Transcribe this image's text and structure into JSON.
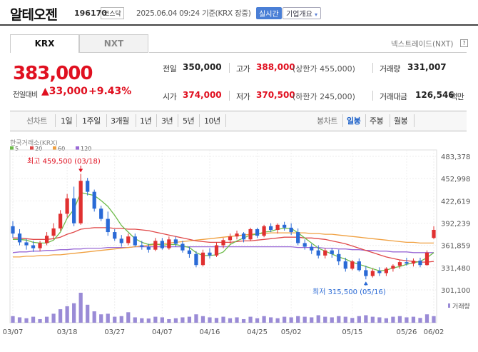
{
  "header": {
    "name": "알테오젠",
    "code": "196170",
    "market": "코스닥",
    "datetime": "2025.06.04 09:24 기준(KRX 장중)",
    "realtime_btn": "실시간",
    "company_btn": "기업개요",
    "company_btn_arrow": "▾"
  },
  "tabs": {
    "krx": "KRX",
    "nxt": "NXT"
  },
  "nextrade": {
    "label": "넥스트레이드(NXT)",
    "icon_glyph": "?"
  },
  "quote": {
    "price": "383,000",
    "change_label": "전일대비",
    "change_arrow": "▲",
    "change_value": "33,000",
    "change_pct": "+9.43%"
  },
  "stats": {
    "prev_close": {
      "label": "전일",
      "value": "350,000"
    },
    "high": {
      "label": "고가",
      "value": "388,000",
      "sub": "(상한가 455,000)"
    },
    "volume": {
      "label": "거래량",
      "value": "331,007"
    },
    "open": {
      "label": "시가",
      "value": "374,000"
    },
    "low": {
      "label": "저가",
      "value": "370,500",
      "sub": "(하한가 245,000)"
    },
    "trade_value": {
      "label": "거래대금",
      "value": "126,546",
      "unit": "백만"
    }
  },
  "period_bar": {
    "line_label": "선차트",
    "line_periods": [
      "1일",
      "1주일",
      "3개월",
      "1년",
      "3년",
      "5년",
      "10년"
    ],
    "candle_label": "봉차트",
    "candle_periods": [
      "일봉",
      "주봉",
      "월봉"
    ],
    "active": "일봉"
  },
  "chart_source": "한국거래소(KRX)",
  "chart_data": {
    "type": "candlestick",
    "moving_averages": [
      {
        "name": "5",
        "color": "#6dbb4a"
      },
      {
        "name": "20",
        "color": "#e04848"
      },
      {
        "name": "60",
        "color": "#f0a040"
      },
      {
        "name": "120",
        "color": "#9a6ad6"
      }
    ],
    "up_color": "#e03030",
    "down_color": "#2a6ad6",
    "y_ticks": [
      "483,378",
      "452,998",
      "422,619",
      "392,239",
      "361,859",
      "331,480",
      "301,100"
    ],
    "ylim": [
      301100,
      483378
    ],
    "x_ticks": [
      "03/07",
      "03/18",
      "03/27",
      "04/07",
      "04/16",
      "04/25",
      "05/02",
      "05/15",
      "05/26",
      "06/02"
    ],
    "max_annotation": "최고 459,500 (03/18)",
    "min_annotation": "최저 315,500 (05/16)",
    "volume_label": "거래량",
    "candles": [
      [
        388000,
        395000,
        372000,
        378000
      ],
      [
        378000,
        384000,
        362000,
        366000
      ],
      [
        366000,
        371000,
        356000,
        362000
      ],
      [
        362000,
        368000,
        353000,
        358000
      ],
      [
        358000,
        368000,
        354000,
        365000
      ],
      [
        365000,
        380000,
        362000,
        375000
      ],
      [
        375000,
        392000,
        370000,
        385000
      ],
      [
        385000,
        410000,
        382000,
        405000
      ],
      [
        405000,
        432000,
        400000,
        426000
      ],
      [
        426000,
        442000,
        388000,
        392000
      ],
      [
        392000,
        459500,
        390000,
        450000
      ],
      [
        450000,
        454000,
        430000,
        435000
      ],
      [
        435000,
        438000,
        408000,
        412000
      ],
      [
        412000,
        416000,
        395000,
        398000
      ],
      [
        398000,
        408000,
        375000,
        380000
      ],
      [
        380000,
        384000,
        368000,
        371000
      ],
      [
        371000,
        376000,
        360000,
        365000
      ],
      [
        365000,
        378000,
        362000,
        374000
      ],
      [
        374000,
        378000,
        360000,
        362000
      ],
      [
        362000,
        368000,
        356000,
        360000
      ],
      [
        360000,
        364000,
        352000,
        356000
      ],
      [
        356000,
        372000,
        354000,
        368000
      ],
      [
        368000,
        372000,
        356000,
        358000
      ],
      [
        358000,
        374000,
        356000,
        370000
      ],
      [
        370000,
        374000,
        360000,
        364000
      ],
      [
        364000,
        368000,
        352000,
        355000
      ],
      [
        355000,
        360000,
        345000,
        350000
      ],
      [
        350000,
        354000,
        332000,
        335000
      ],
      [
        335000,
        356000,
        333000,
        352000
      ],
      [
        352000,
        358000,
        344000,
        348000
      ],
      [
        348000,
        366000,
        346000,
        362000
      ],
      [
        362000,
        372000,
        358000,
        369000
      ],
      [
        369000,
        378000,
        364000,
        374000
      ],
      [
        374000,
        382000,
        370000,
        378000
      ],
      [
        378000,
        380000,
        366000,
        370000
      ],
      [
        370000,
        386000,
        368000,
        384000
      ],
      [
        384000,
        386000,
        372000,
        375000
      ],
      [
        375000,
        390000,
        373000,
        388000
      ],
      [
        388000,
        392000,
        380000,
        383000
      ],
      [
        383000,
        392000,
        378000,
        390000
      ],
      [
        390000,
        394000,
        382000,
        386000
      ],
      [
        386000,
        392000,
        376000,
        380000
      ],
      [
        380000,
        385000,
        362000,
        365000
      ],
      [
        365000,
        370000,
        356000,
        360000
      ],
      [
        360000,
        364000,
        350000,
        355000
      ],
      [
        355000,
        362000,
        344000,
        348000
      ],
      [
        348000,
        358000,
        344000,
        355000
      ],
      [
        355000,
        358000,
        345000,
        350000
      ],
      [
        350000,
        356000,
        335000,
        340000
      ],
      [
        340000,
        345000,
        326000,
        330000
      ],
      [
        330000,
        342000,
        328000,
        340000
      ],
      [
        340000,
        344000,
        326000,
        328000
      ],
      [
        328000,
        334000,
        315500,
        320000
      ],
      [
        320000,
        330000,
        318000,
        327000
      ],
      [
        327000,
        332000,
        320000,
        324000
      ],
      [
        324000,
        332000,
        320000,
        330000
      ],
      [
        330000,
        336000,
        326000,
        334000
      ],
      [
        334000,
        342000,
        330000,
        339000
      ],
      [
        339000,
        345000,
        334000,
        337000
      ],
      [
        337000,
        344000,
        333000,
        341000
      ],
      [
        341000,
        345000,
        332000,
        335000
      ],
      [
        335000,
        355000,
        334000,
        352000
      ],
      [
        372000,
        388000,
        370500,
        383000
      ]
    ],
    "ma5": [
      370000,
      370000,
      369000,
      366000,
      365000,
      365000,
      369000,
      380000,
      399000,
      411000,
      434000,
      432000,
      430000,
      423000,
      415000,
      403000,
      389000,
      380000,
      371000,
      366000,
      363000,
      364000,
      362000,
      363000,
      363000,
      361000,
      359000,
      352000,
      348000,
      348000,
      349000,
      353000,
      363000,
      368000,
      372000,
      376000,
      377000,
      380000,
      381000,
      384000,
      385000,
      385000,
      379000,
      372000,
      365000,
      358000,
      354000,
      350000,
      346000,
      343000,
      339000,
      336000,
      333000,
      330000,
      327000,
      328000,
      331000,
      333000,
      336000,
      338000,
      340000,
      345000,
      352000
    ],
    "ma20": [
      372000,
      372000,
      371000,
      370000,
      370000,
      370000,
      371000,
      373000,
      377000,
      380000,
      384000,
      385000,
      386000,
      386000,
      386000,
      385000,
      385000,
      384000,
      384000,
      383000,
      382000,
      380000,
      378000,
      376000,
      374000,
      372000,
      370000,
      368000,
      367000,
      366000,
      366000,
      366000,
      366000,
      367000,
      368000,
      368000,
      369000,
      370000,
      371000,
      372000,
      373000,
      373000,
      373000,
      372000,
      372000,
      371000,
      370000,
      368000,
      366000,
      364000,
      361000,
      358000,
      355000,
      352000,
      349000,
      346000,
      344000,
      342000,
      341000,
      340000,
      339000,
      339000,
      340000
    ],
    "ma60": [
      346000,
      346000,
      347000,
      347000,
      348000,
      348000,
      349000,
      349000,
      350000,
      351000,
      352000,
      353000,
      354000,
      355000,
      356000,
      357000,
      358000,
      359000,
      360000,
      361000,
      362000,
      363000,
      364000,
      365000,
      366000,
      367000,
      368000,
      369000,
      370000,
      371000,
      372000,
      373000,
      374000,
      375000,
      376000,
      377000,
      378000,
      378000,
      379000,
      379000,
      379000,
      379000,
      379000,
      379000,
      378000,
      378000,
      377000,
      377000,
      376000,
      375000,
      374000,
      373000,
      372000,
      371000,
      370000,
      369000,
      368000,
      367000,
      366000,
      366000,
      365000,
      365000,
      365000
    ],
    "ma120": [
      352000,
      353000,
      353000,
      354000,
      354000,
      355000,
      355000,
      356000,
      356000,
      357000,
      357000,
      358000,
      358000,
      358000,
      359000,
      359000,
      359000,
      359000,
      360000,
      360000,
      360000,
      360000,
      360000,
      360000,
      360000,
      360000,
      360000,
      360000,
      360000,
      360000,
      360000,
      360000,
      360000,
      360000,
      360000,
      360000,
      360000,
      360000,
      360000,
      360000,
      360000,
      360000,
      359000,
      359000,
      359000,
      359000,
      358000,
      358000,
      357000,
      357000,
      356000,
      356000,
      355000,
      355000,
      354000,
      354000,
      353000,
      353000,
      353000,
      352000,
      352000,
      352000,
      352000
    ],
    "volume": [
      0.22,
      0.18,
      0.15,
      0.2,
      0.12,
      0.2,
      0.3,
      0.45,
      0.55,
      0.65,
      1.0,
      0.6,
      0.38,
      0.28,
      0.3,
      0.2,
      0.22,
      0.35,
      0.18,
      0.15,
      0.14,
      0.2,
      0.18,
      0.12,
      0.15,
      0.18,
      0.2,
      0.28,
      0.22,
      0.18,
      0.16,
      0.2,
      0.15,
      0.18,
      0.12,
      0.2,
      0.15,
      0.22,
      0.18,
      0.15,
      0.2,
      0.18,
      0.22,
      0.2,
      0.18,
      0.25,
      0.2,
      0.18,
      0.22,
      0.2,
      0.16,
      0.22,
      0.25,
      0.2,
      0.18,
      0.15,
      0.2,
      0.22,
      0.18,
      0.2,
      0.16,
      0.28,
      0.22
    ]
  }
}
